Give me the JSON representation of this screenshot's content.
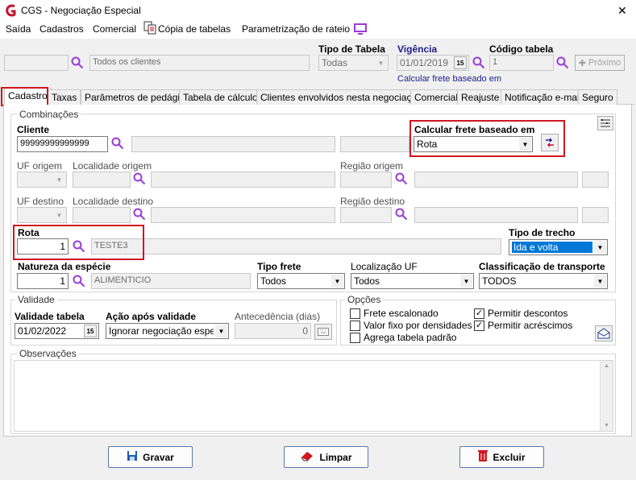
{
  "window": {
    "title": "CGS - Negociação Especial",
    "close": "✕"
  },
  "menu": {
    "items": [
      "Saída",
      "Cadastros",
      "Comercial",
      "Cópia de tabelas",
      "Parametrização de rateio"
    ]
  },
  "header": {
    "cliente_value": "",
    "cliente_desc": "Todos os clientes",
    "tipo_tabela_label": "Tipo de Tabela",
    "tipo_tabela_value": "Todas",
    "vigencia_label": "Vigência",
    "vigencia_value": "01/01/2019",
    "vigencia_note": "Calcular frete baseado em",
    "codigo_tabela_label": "Código tabela",
    "codigo_tabela_value": "1",
    "proximo_label": "Próximo"
  },
  "tabs": [
    "Cadastro",
    "Taxas",
    "Parâmetros de pedágio",
    "Tabela de cálculo",
    "Clientes envolvidos nesta negociação",
    "Comercial",
    "Reajuste",
    "Notificação e-mail",
    "Seguro"
  ],
  "combinacoes": {
    "title": "Combinações",
    "cliente_label": "Cliente",
    "cliente_value": "99999999999999",
    "calcular_label": "Calcular frete baseado em",
    "calcular_value": "Rota",
    "uf_origem_label": "UF origem",
    "localidade_origem_label": "Localidade origem",
    "regiao_origem_label": "Região origem",
    "uf_destino_label": "UF destino",
    "localidade_destino_label": "Localidade destino",
    "regiao_destino_label": "Região destino",
    "rota_label": "Rota",
    "rota_value": "1",
    "rota_desc": "TESTE3",
    "tipo_trecho_label": "Tipo de trecho",
    "tipo_trecho_value": "Ida e volta",
    "natureza_label": "Natureza da espécie",
    "natureza_value": "1",
    "natureza_desc": "ALIMENTICIO",
    "tipo_frete_label": "Tipo frete",
    "tipo_frete_value": "Todos",
    "localizacao_uf_label": "Localização UF",
    "localizacao_uf_value": "Todos",
    "classificacao_label": "Classificação de transporte",
    "classificacao_value": "TODOS"
  },
  "validade": {
    "title": "Validade",
    "validade_tabela_label": "Validade tabela",
    "validade_tabela_value": "01/02/2022",
    "acao_label": "Ação após validade",
    "acao_value": "Ignorar negociação especial",
    "antecedencia_label": "Antecedência (dias)",
    "antecedencia_value": "0"
  },
  "opcoes": {
    "title": "Opções",
    "frete_escalonado": "Frete escalonado",
    "valor_fixo": "Valor fixo por densidades",
    "agrega_tabela": "Agrega tabela padrão",
    "permitir_descontos": "Permitir descontos",
    "permitir_acrescimos": "Permitir acréscimos"
  },
  "observacoes": {
    "title": "Observações"
  },
  "footer": {
    "gravar": "Gravar",
    "limpar": "Limpar",
    "excluir": "Excluir"
  },
  "colors": {
    "highlight": "#d0161e",
    "selection": "#0078d7",
    "accent_purple": "#9b3bd6"
  }
}
